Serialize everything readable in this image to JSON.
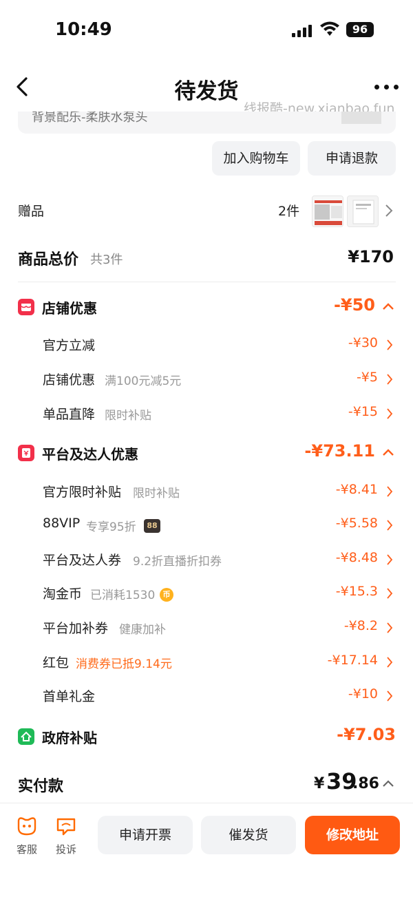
{
  "status_bar": {
    "time": "10:49",
    "battery": "96"
  },
  "nav": {
    "title": "待发货"
  },
  "watermark": "线报酷-new.xianbao.fun",
  "product": {
    "name": "背景配乐-柔肤水泵头"
  },
  "actions": {
    "add_to_cart": "加入购物车",
    "refund": "申请退款"
  },
  "gift": {
    "label": "赠品",
    "count": "2件"
  },
  "total": {
    "label": "商品总价",
    "count": "共3件",
    "value": "¥170"
  },
  "store_discount": {
    "title": "店铺优惠",
    "value": "-¥50",
    "items": [
      {
        "label": "官方立减",
        "sub": "",
        "value": "-¥30"
      },
      {
        "label": "店铺优惠",
        "sub": "满100元减5元",
        "value": "-¥5"
      },
      {
        "label": "单品直降",
        "sub": "限时补贴",
        "value": "-¥15"
      }
    ]
  },
  "platform_discount": {
    "title": "平台及达人优惠",
    "value": "-¥73.11",
    "items": [
      {
        "label": "官方限时补贴",
        "sub": "限时补贴",
        "value": "-¥8.41"
      },
      {
        "label": "88VIP",
        "sub": "专享95折",
        "badge": "88",
        "value": "-¥5.58"
      },
      {
        "label": "平台及达人券",
        "sub": "9.2折直播折扣券",
        "value": "-¥8.48"
      },
      {
        "label": "淘金币",
        "sub": "已消耗1530",
        "coin": "币",
        "value": "-¥15.3"
      },
      {
        "label": "平台加补券",
        "sub": "健康加补",
        "value": "-¥8.2"
      },
      {
        "label": "红包",
        "sub": "消费券已抵9.14元",
        "value": "-¥17.14"
      },
      {
        "label": "首单礼金",
        "sub": "",
        "value": "-¥10"
      }
    ]
  },
  "gov_subsidy": {
    "title": "政府补贴",
    "value": "-¥7.03"
  },
  "payment": {
    "label": "实付款",
    "currency": "¥",
    "integer": "39",
    "decimal": ".86"
  },
  "bottom": {
    "service_label": "客服",
    "complain_label": "投诉",
    "invoice": "申请开票",
    "urge": "催发货",
    "change_address": "修改地址"
  },
  "colors": {
    "accent": "#ff5e1a",
    "primary_button": "#ff5a12",
    "store_icon": "#f2304a",
    "gov_icon": "#1fba57"
  }
}
